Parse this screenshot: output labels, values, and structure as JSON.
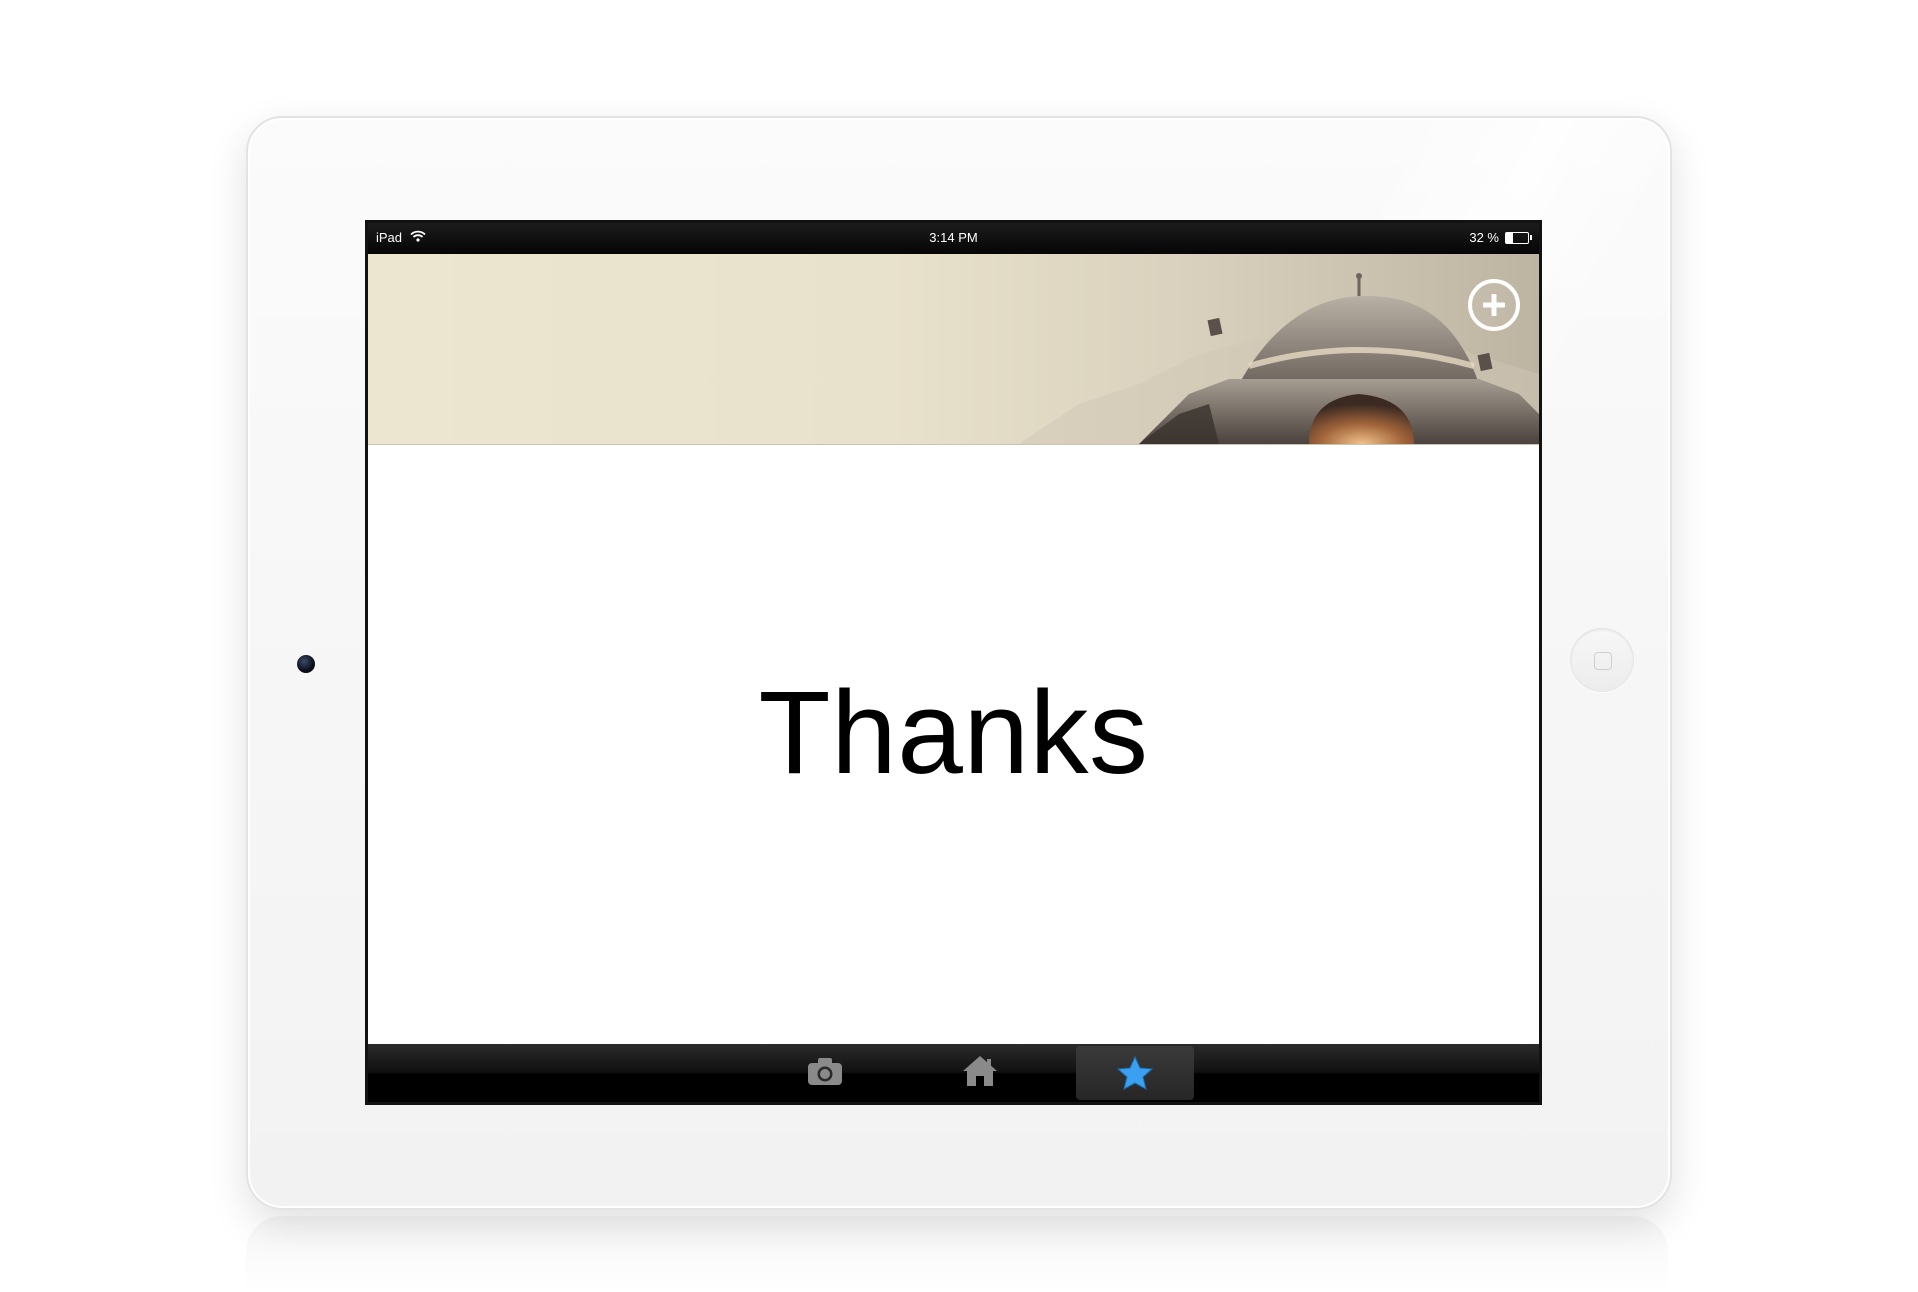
{
  "status_bar": {
    "device_label": "iPad",
    "time": "3:14 PM",
    "battery_text": "32 %",
    "battery_level": 0.32,
    "wifi_icon": "wifi-icon"
  },
  "header": {
    "add_icon": "plus-circle-icon"
  },
  "main": {
    "message": "Thanks"
  },
  "tab_bar": {
    "tabs": [
      {
        "icon": "camera-icon",
        "active": false
      },
      {
        "icon": "home-icon",
        "active": false
      },
      {
        "icon": "star-icon",
        "active": true
      }
    ],
    "active_color": "#3aa0ef",
    "inactive_color": "#8a8a8a"
  }
}
